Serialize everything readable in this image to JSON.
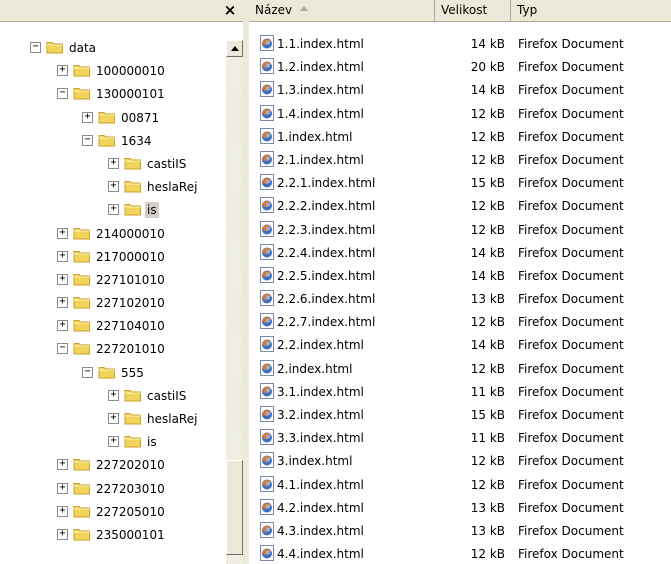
{
  "tree": {
    "close_glyph": "×",
    "items": [
      {
        "label": "data",
        "expander": "−",
        "depth": 0
      },
      {
        "label": "100000010",
        "expander": "+",
        "depth": 1
      },
      {
        "label": "130000101",
        "expander": "−",
        "depth": 1
      },
      {
        "label": "00871",
        "expander": "+",
        "depth": 2
      },
      {
        "label": "1634",
        "expander": "−",
        "depth": 2
      },
      {
        "label": "castiIS",
        "expander": "+",
        "depth": 3
      },
      {
        "label": "heslaRej",
        "expander": "+",
        "depth": 3
      },
      {
        "label": "is",
        "expander": "+",
        "depth": 3,
        "selected": true
      },
      {
        "label": "214000010",
        "expander": "+",
        "depth": 1
      },
      {
        "label": "217000010",
        "expander": "+",
        "depth": 1
      },
      {
        "label": "227101010",
        "expander": "+",
        "depth": 1
      },
      {
        "label": "227102010",
        "expander": "+",
        "depth": 1
      },
      {
        "label": "227104010",
        "expander": "+",
        "depth": 1
      },
      {
        "label": "227201010",
        "expander": "−",
        "depth": 1
      },
      {
        "label": "555",
        "expander": "−",
        "depth": 2
      },
      {
        "label": "castiIS",
        "expander": "+",
        "depth": 3
      },
      {
        "label": "heslaRej",
        "expander": "+",
        "depth": 3
      },
      {
        "label": "is",
        "expander": "+",
        "depth": 3
      },
      {
        "label": "227202010",
        "expander": "+",
        "depth": 1
      },
      {
        "label": "227203010",
        "expander": "+",
        "depth": 1
      },
      {
        "label": "227205010",
        "expander": "+",
        "depth": 1
      },
      {
        "label": "235000101",
        "expander": "+",
        "depth": 1
      }
    ]
  },
  "list": {
    "columns": {
      "name": "Název",
      "size": "Velikost",
      "type": "Typ"
    },
    "files": [
      {
        "name": "1.1.index.html",
        "size": "14 kB",
        "type": "Firefox Document"
      },
      {
        "name": "1.2.index.html",
        "size": "20 kB",
        "type": "Firefox Document"
      },
      {
        "name": "1.3.index.html",
        "size": "14 kB",
        "type": "Firefox Document"
      },
      {
        "name": "1.4.index.html",
        "size": "12 kB",
        "type": "Firefox Document"
      },
      {
        "name": "1.index.html",
        "size": "12 kB",
        "type": "Firefox Document"
      },
      {
        "name": "2.1.index.html",
        "size": "12 kB",
        "type": "Firefox Document"
      },
      {
        "name": "2.2.1.index.html",
        "size": "15 kB",
        "type": "Firefox Document"
      },
      {
        "name": "2.2.2.index.html",
        "size": "12 kB",
        "type": "Firefox Document"
      },
      {
        "name": "2.2.3.index.html",
        "size": "12 kB",
        "type": "Firefox Document"
      },
      {
        "name": "2.2.4.index.html",
        "size": "14 kB",
        "type": "Firefox Document"
      },
      {
        "name": "2.2.5.index.html",
        "size": "14 kB",
        "type": "Firefox Document"
      },
      {
        "name": "2.2.6.index.html",
        "size": "13 kB",
        "type": "Firefox Document"
      },
      {
        "name": "2.2.7.index.html",
        "size": "12 kB",
        "type": "Firefox Document"
      },
      {
        "name": "2.2.index.html",
        "size": "14 kB",
        "type": "Firefox Document"
      },
      {
        "name": "2.index.html",
        "size": "12 kB",
        "type": "Firefox Document"
      },
      {
        "name": "3.1.index.html",
        "size": "11 kB",
        "type": "Firefox Document"
      },
      {
        "name": "3.2.index.html",
        "size": "15 kB",
        "type": "Firefox Document"
      },
      {
        "name": "3.3.index.html",
        "size": "11 kB",
        "type": "Firefox Document"
      },
      {
        "name": "3.index.html",
        "size": "12 kB",
        "type": "Firefox Document"
      },
      {
        "name": "4.1.index.html",
        "size": "12 kB",
        "type": "Firefox Document"
      },
      {
        "name": "4.2.index.html",
        "size": "13 kB",
        "type": "Firefox Document"
      },
      {
        "name": "4.3.index.html",
        "size": "13 kB",
        "type": "Firefox Document"
      },
      {
        "name": "4.4.index.html",
        "size": "12 kB",
        "type": "Firefox Document"
      }
    ]
  },
  "icons": {
    "folder": "folder-icon",
    "file": "firefox-document-icon",
    "folder_color": "#f3d45a",
    "folder_edge": "#c9a227"
  }
}
